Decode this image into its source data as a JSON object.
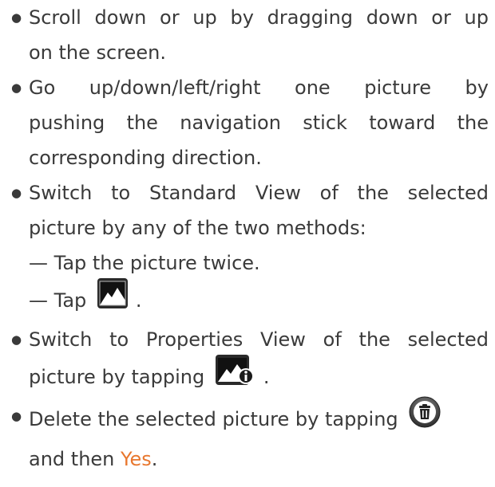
{
  "bullets": [
    {
      "lines": [
        "Scroll down or up by dragging down or up",
        "on the screen."
      ]
    },
    {
      "lines": [
        "Go up/down/left/right one picture by",
        "pushing the navigation stick toward the",
        "corresponding direction."
      ]
    },
    {
      "lines": [
        "Switch to Standard View of the selected",
        "picture by any of the two methods:"
      ],
      "sub": [
        "— Tap the picture twice.",
        "— Tap",
        "."
      ]
    },
    {
      "lines": [
        "Switch to Properties View of the selected",
        "picture by tapping",
        "."
      ]
    },
    {
      "lines": [
        "Delete the selected picture by tapping",
        "and then",
        "Yes",
        "."
      ]
    }
  ],
  "bullet_glyph": "●",
  "colors": {
    "text": "#3a3a3a",
    "highlight": "#e8772e"
  },
  "icons": {
    "standard_view": "picture-icon",
    "properties_view": "picture-info-icon",
    "delete": "trash-icon"
  }
}
